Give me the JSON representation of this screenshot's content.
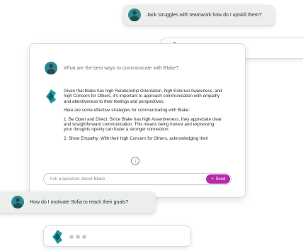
{
  "top_bubble": {
    "text": "Jack struggles with teamwork how do I upskill them?"
  },
  "typing_bubble_top": {
    "icon": "brand-logo-icon"
  },
  "chat_card": {
    "question": "What are the best ways to communicate with Blake?",
    "answer_paragraphs": [
      "Given that Blake has high Relationship Orientation, high External Awareness, and high Concern for Others, it's important to approach communication with empathy and attentiveness to their feelings and perspectives.",
      "Here are some effective strategies for communicating with Blake:",
      "1. Be Open and Direct: Since Blake has high Assertiveness, they appreciate clear and straightforward communication. This means being honest and expressing your thoughts openly can foster a stronger connection.",
      "2. Show Empathy: With their high Concern for Others, acknowledging their"
    ],
    "input_placeholder": "Ask a question about Blake",
    "send_label": "Send"
  },
  "bottom_bubble": {
    "text": "How do I motivate Sofia to reach their goals?"
  },
  "typing_bubble_bottom": {
    "icon": "brand-logo-icon"
  },
  "colors": {
    "brand": "#1f9aa3",
    "send": "#b52aa9",
    "avatar": "#2f8a8f"
  }
}
